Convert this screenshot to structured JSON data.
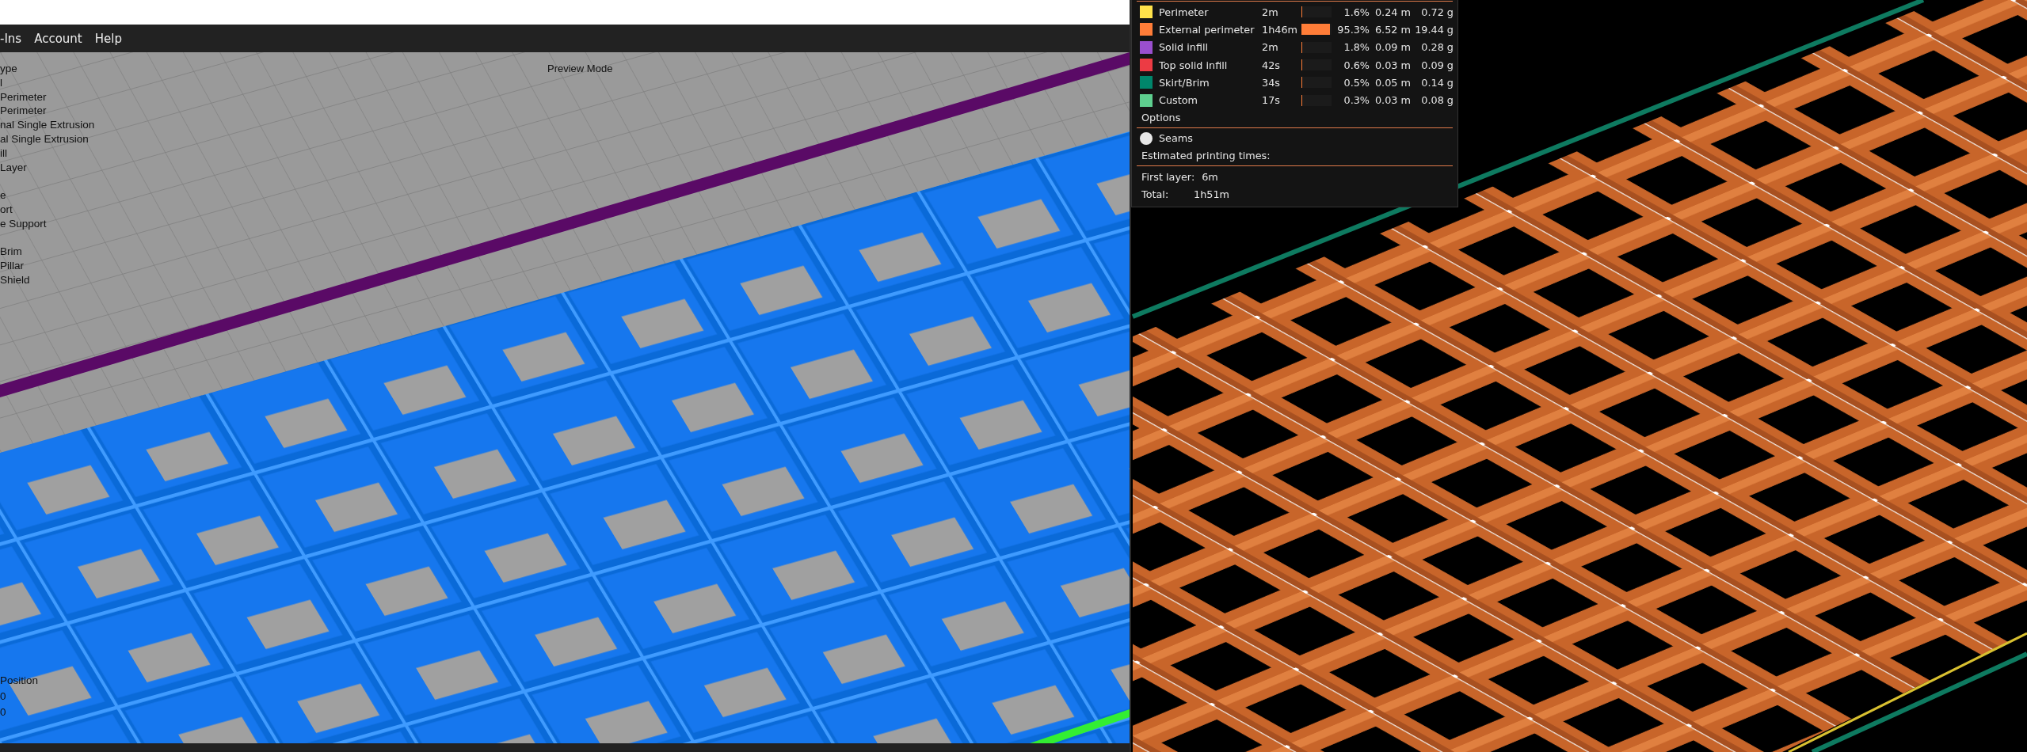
{
  "left_window": {
    "menu": [
      "-Ins",
      "Account",
      "Help"
    ],
    "viewport": {
      "mode_label": "Preview Mode",
      "legend_groups": [
        [
          "ype",
          "l",
          "Perimeter",
          "Perimeter",
          "nal Single Extrusion",
          "al Single Extrusion",
          "ill",
          "Layer"
        ],
        [
          "e",
          "ort",
          "e Support"
        ],
        [
          "Brim",
          "Pillar",
          "Shield"
        ]
      ],
      "position_texts": [
        "Position",
        "0",
        "0"
      ]
    }
  },
  "right_window": {
    "legend": {
      "items": [
        {
          "name": "Perimeter",
          "color": "#ffe24a",
          "time": "2m",
          "level": 0.016,
          "percent": "1.6%",
          "length": "0.24 m",
          "weight": "0.72 g"
        },
        {
          "name": "External perimeter",
          "color": "#ff7d38",
          "time": "1h46m",
          "level": 0.953,
          "percent": "95.3%",
          "length": "6.52 m",
          "weight": "19.44 g"
        },
        {
          "name": "Solid infill",
          "color": "#9a4fce",
          "time": "2m",
          "level": 0.018,
          "percent": "1.8%",
          "length": "0.09 m",
          "weight": "0.28 g"
        },
        {
          "name": "Top solid infill",
          "color": "#ec3b44",
          "time": "42s",
          "level": 0.006,
          "percent": "0.6%",
          "length": "0.03 m",
          "weight": "0.09 g"
        },
        {
          "name": "Skirt/Brim",
          "color": "#00866b",
          "time": "34s",
          "level": 0.005,
          "percent": "0.5%",
          "length": "0.05 m",
          "weight": "0.14 g"
        },
        {
          "name": "Custom",
          "color": "#5ecf8f",
          "time": "17s",
          "level": 0.003,
          "percent": "0.3%",
          "length": "0.03 m",
          "weight": "0.08 g"
        }
      ],
      "options_title": "Options",
      "options": [
        {
          "label": "Seams"
        }
      ],
      "times_title": "Estimated printing times:",
      "times": [
        {
          "label": "First layer:",
          "value": "6m"
        },
        {
          "label": "Total:",
          "value": "1h51m"
        }
      ]
    }
  }
}
